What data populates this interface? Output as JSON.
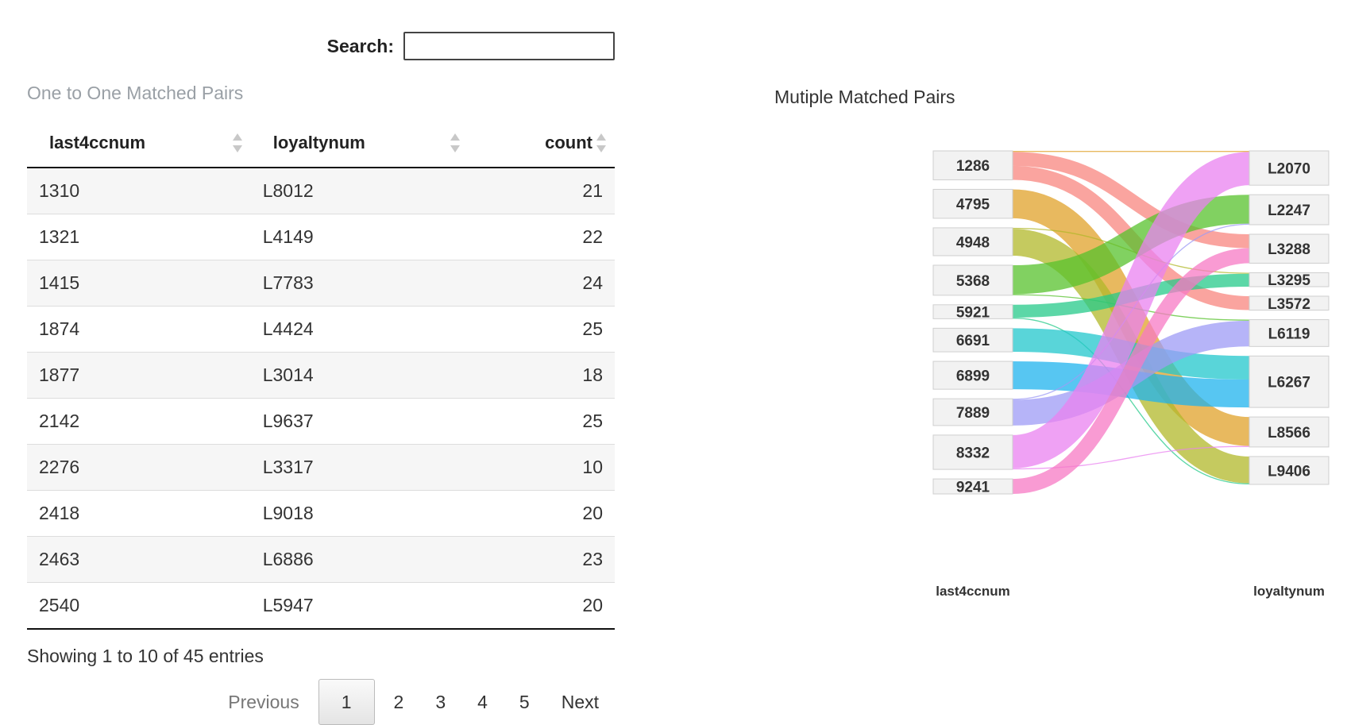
{
  "search": {
    "label": "Search:",
    "value": ""
  },
  "table_caption": "One to One Matched Pairs",
  "table": {
    "headers": [
      "last4ccnum",
      "loyaltynum",
      "count"
    ],
    "rows": [
      [
        "1310",
        "L8012",
        "21"
      ],
      [
        "1321",
        "L4149",
        "22"
      ],
      [
        "1415",
        "L7783",
        "24"
      ],
      [
        "1874",
        "L4424",
        "25"
      ],
      [
        "1877",
        "L3014",
        "18"
      ],
      [
        "2142",
        "L9637",
        "25"
      ],
      [
        "2276",
        "L3317",
        "10"
      ],
      [
        "2418",
        "L9018",
        "20"
      ],
      [
        "2463",
        "L6886",
        "23"
      ],
      [
        "2540",
        "L5947",
        "20"
      ]
    ]
  },
  "info": "Showing 1 to 10 of 45 entries",
  "pagination": {
    "previous": "Previous",
    "pages": [
      "1",
      "2",
      "3",
      "4",
      "5"
    ],
    "current": "1",
    "next": "Next"
  },
  "sankey_title": "Mutiple Matched Pairs",
  "chart_data": {
    "type": "sankey",
    "left_axis_label": "last4ccnum",
    "right_axis_label": "loyaltynum",
    "left_nodes": [
      "1286",
      "4795",
      "4948",
      "5368",
      "5921",
      "6691",
      "6899",
      "7889",
      "8332",
      "9241"
    ],
    "right_nodes": [
      "L2070",
      "L2247",
      "L3288",
      "L3295",
      "L3572",
      "L6119",
      "L6267",
      "L8566",
      "L9406"
    ],
    "links": [
      {
        "source": "1286",
        "target": "L3288",
        "value": 13,
        "color": "#f8867f"
      },
      {
        "source": "1286",
        "target": "L3572",
        "value": 13,
        "color": "#f8867f"
      },
      {
        "source": "1286",
        "target": "L2070",
        "value": 1,
        "color": "#e0a22a"
      },
      {
        "source": "4795",
        "target": "L8566",
        "value": 27,
        "color": "#e0a22a"
      },
      {
        "source": "4948",
        "target": "L9406",
        "value": 25,
        "color": "#b2b82a"
      },
      {
        "source": "4948",
        "target": "L3295",
        "value": 1,
        "color": "#b2b82a"
      },
      {
        "source": "5368",
        "target": "L2247",
        "value": 27,
        "color": "#57c12c"
      },
      {
        "source": "5368",
        "target": "L6119",
        "value": 1,
        "color": "#57c12c"
      },
      {
        "source": "5921",
        "target": "L3295",
        "value": 12,
        "color": "#26c98a"
      },
      {
        "source": "5921",
        "target": "L9406",
        "value": 1,
        "color": "#26c98a"
      },
      {
        "source": "6691",
        "target": "L6267",
        "value": 22,
        "color": "#21c7cc"
      },
      {
        "source": "6899",
        "target": "L6267",
        "value": 26,
        "color": "#1fb3ee"
      },
      {
        "source": "7889",
        "target": "L6119",
        "value": 24,
        "color": "#9d9bf5"
      },
      {
        "source": "7889",
        "target": "L2247",
        "value": 1,
        "color": "#9d9bf5"
      },
      {
        "source": "8332",
        "target": "L2070",
        "value": 31,
        "color": "#e982f0"
      },
      {
        "source": "8332",
        "target": "L8566",
        "value": 1,
        "color": "#e982f0"
      },
      {
        "source": "9241",
        "target": "L3288",
        "value": 14,
        "color": "#f77ac4"
      }
    ]
  }
}
